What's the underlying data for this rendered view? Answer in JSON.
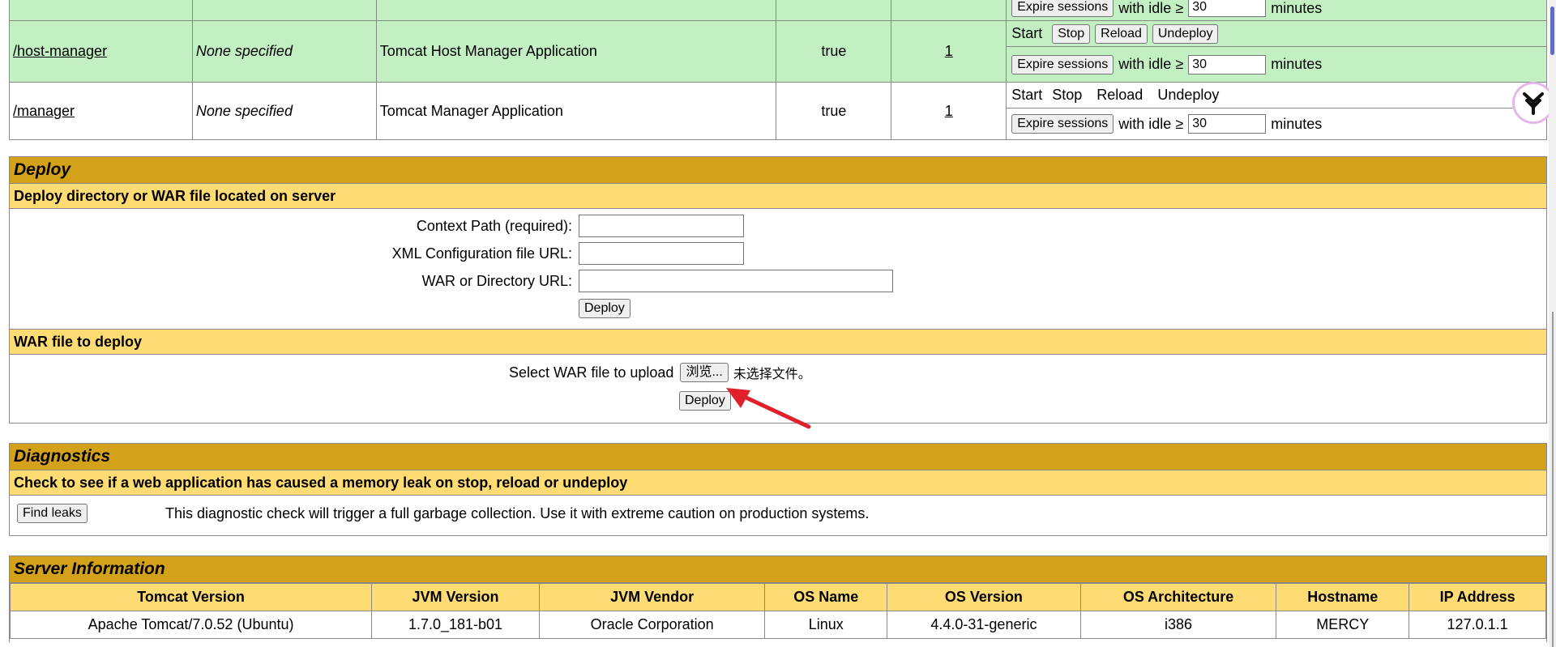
{
  "apps": {
    "top_row": {
      "expire_label": "Expire sessions",
      "with_idle": "with idle ≥",
      "idle_value": "30",
      "minutes": "minutes"
    },
    "rows": [
      {
        "path": "/host-manager",
        "version": "None specified",
        "display_name": "Tomcat Host Manager Application",
        "running": "true",
        "sessions": "1",
        "start": "Start",
        "stop": "Stop",
        "reload": "Reload",
        "undeploy": "Undeploy",
        "expire_label": "Expire sessions",
        "with_idle": "with idle ≥",
        "idle_value": "30",
        "minutes": "minutes"
      },
      {
        "path": "/manager",
        "version": "None specified",
        "display_name": "Tomcat Manager Application",
        "running": "true",
        "sessions": "1",
        "start": "Start",
        "stop": "Stop",
        "reload": "Reload",
        "undeploy": "Undeploy",
        "expire_label": "Expire sessions",
        "with_idle": "with idle ≥",
        "idle_value": "30",
        "minutes": "minutes"
      }
    ]
  },
  "deploy": {
    "title": "Deploy",
    "server_subtitle": "Deploy directory or WAR file located on server",
    "context_path_label": "Context Path (required):",
    "xml_config_label": "XML Configuration file URL:",
    "war_dir_label": "WAR or Directory URL:",
    "deploy_button": "Deploy",
    "war_subtitle": "WAR file to deploy",
    "select_war_label": "Select WAR file to upload",
    "browse_button": "浏览...",
    "no_file": "未选择文件。",
    "upload_deploy_button": "Deploy"
  },
  "diagnostics": {
    "title": "Diagnostics",
    "subtitle": "Check to see if a web application has caused a memory leak on stop, reload or undeploy",
    "find_leaks_button": "Find leaks",
    "description": "This diagnostic check will trigger a full garbage collection. Use it with extreme caution on production systems."
  },
  "server_info": {
    "title": "Server Information",
    "headers": [
      "Tomcat Version",
      "JVM Version",
      "JVM Vendor",
      "OS Name",
      "OS Version",
      "OS Architecture",
      "Hostname",
      "IP Address"
    ],
    "values": [
      "Apache Tomcat/7.0.52 (Ubuntu)",
      "1.7.0_181-b01",
      "Oracle Corporation",
      "Linux",
      "4.4.0-31-generic",
      "i386",
      "MERCY",
      "127.0.1.1"
    ]
  },
  "colors": {
    "section_title": "#d4a11b",
    "section_subtitle": "#ffdc73",
    "running_row": "#c3f0c3",
    "annotation_arrow": "#e0202a"
  }
}
